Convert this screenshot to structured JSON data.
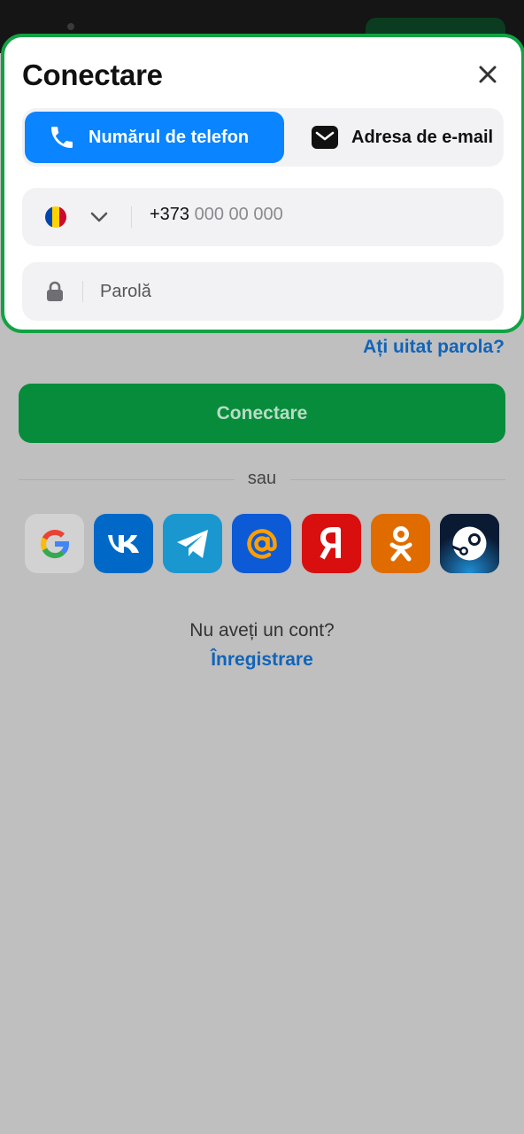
{
  "modal": {
    "title": "Conectare",
    "tabs": [
      {
        "label": "Numărul de telefon",
        "icon": "phone-icon",
        "active": true
      },
      {
        "label": "Adresa de e-mail",
        "icon": "envelope-icon",
        "active": false
      }
    ],
    "phone": {
      "country_flag": "moldova-flag-icon",
      "prefix": "+373",
      "placeholder": "000 00 000"
    },
    "password": {
      "placeholder": "Parolă",
      "icon": "lock-icon"
    }
  },
  "forgot_password": "Ați uitat parola?",
  "submit_label": "Conectare",
  "divider_text": "sau",
  "social": [
    {
      "name": "google",
      "icon": "google-icon"
    },
    {
      "name": "vk",
      "icon": "vk-icon"
    },
    {
      "name": "telegram",
      "icon": "telegram-icon"
    },
    {
      "name": "mail",
      "icon": "mail-ru-icon"
    },
    {
      "name": "yandex",
      "icon": "yandex-icon"
    },
    {
      "name": "odnoklassniki",
      "icon": "odnoklassniki-icon"
    },
    {
      "name": "steam",
      "icon": "steam-icon"
    }
  ],
  "no_account_text": "Nu aveți un cont?",
  "register_label": "Înregistrare",
  "colors": {
    "accent_blue": "#0a84ff",
    "link_blue": "#1164b8",
    "success_green": "#078c3c",
    "modal_border": "#12a244"
  }
}
